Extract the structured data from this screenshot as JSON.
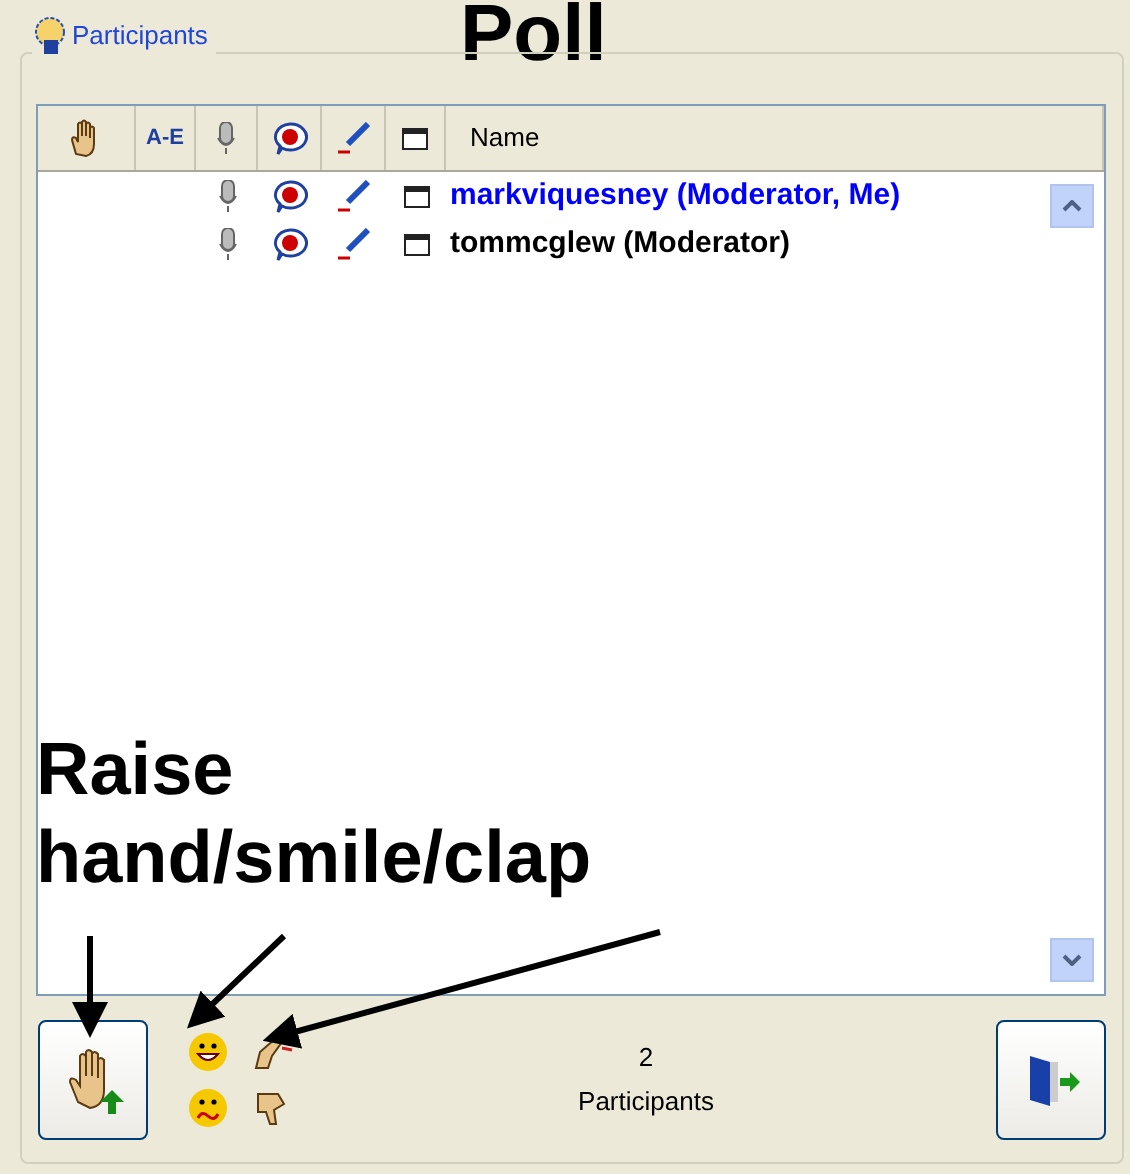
{
  "annotations": {
    "title": "Poll",
    "callout_lines": [
      "Raise",
      "hand/smile/clap"
    ]
  },
  "panel": {
    "legend": "Participants"
  },
  "table": {
    "columns": [
      {
        "kind": "hand"
      },
      {
        "kind": "text",
        "label": "A-E"
      },
      {
        "kind": "mic"
      },
      {
        "kind": "chat"
      },
      {
        "kind": "pen"
      },
      {
        "kind": "window"
      },
      {
        "kind": "text",
        "label": "Name"
      }
    ],
    "rows": [
      {
        "name": "markviquesney (Moderator, Me)",
        "color": "#0000ff"
      },
      {
        "name": "tommcglew (Moderator)",
        "color": "#000000"
      }
    ]
  },
  "footer": {
    "count": "2",
    "count_label": "Participants"
  }
}
